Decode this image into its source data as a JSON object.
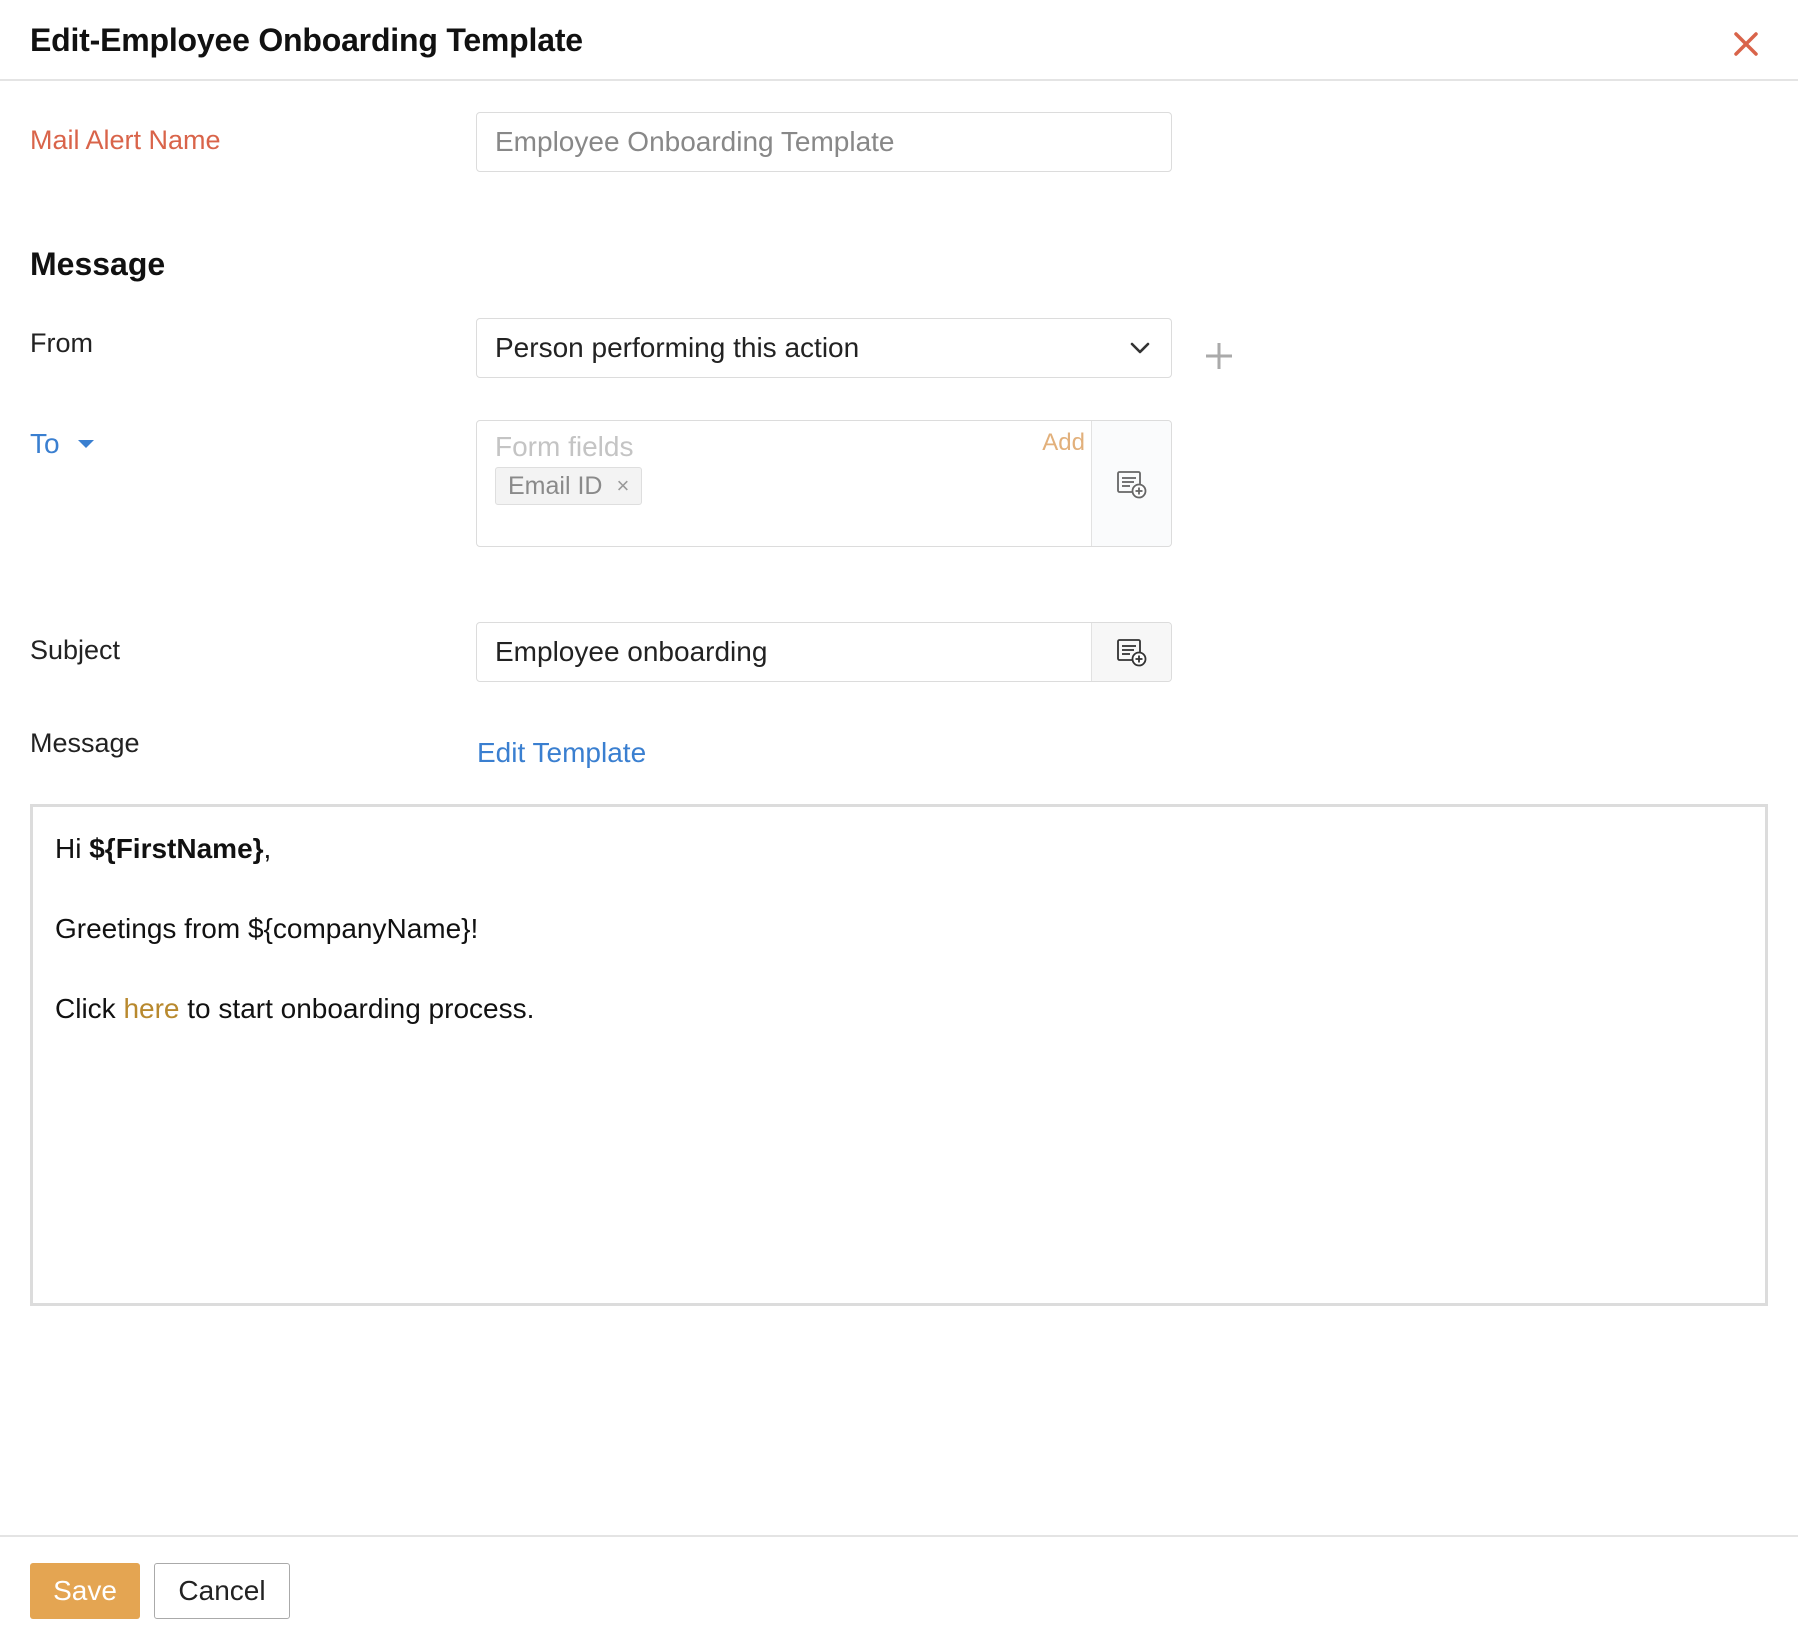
{
  "dialog": {
    "title": "Edit-Employee Onboarding Template"
  },
  "form": {
    "mail_alert_label": "Mail Alert Name",
    "mail_alert_value": "Employee Onboarding Template",
    "section_title": "Message",
    "from_label": "From",
    "from_value": "Person performing this action",
    "to_label": "To",
    "to_placeholder": "Form fields",
    "to_add": "Add",
    "to_chips": [
      {
        "label": "Email ID",
        "remove": "×"
      }
    ],
    "subject_label": "Subject",
    "subject_value": "Employee onboarding",
    "message_label": "Message",
    "edit_template_link": "Edit Template"
  },
  "editor": {
    "line1_prefix": "Hi ",
    "line1_bold": "${FirstName}",
    "line1_suffix": ",",
    "line2": "Greetings from ${companyName}!",
    "line3_prefix": "Click ",
    "line3_link": "here",
    "line3_suffix": " to start onboarding process."
  },
  "footer": {
    "save_label": "Save",
    "cancel_label": "Cancel"
  },
  "icons": {
    "close": "close-icon",
    "dropdown": "chevron-down-icon",
    "add_sender": "plus-icon",
    "to_caret": "caret-down-icon",
    "insert_field": "insert-field-icon"
  },
  "colors": {
    "required_label": "#d9644a",
    "link_blue": "#3a7fd0",
    "accent_orange": "#e4a552",
    "editor_link": "#b8892e",
    "add_text": "#e2b07b"
  }
}
